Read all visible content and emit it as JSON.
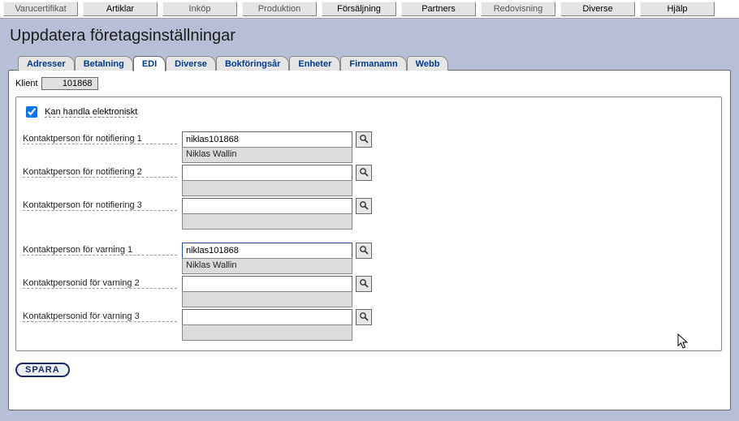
{
  "topbar": {
    "items": [
      {
        "label": "Varucertifikat",
        "enabled": false
      },
      {
        "label": "Artiklar",
        "enabled": true
      },
      {
        "label": "Inköp",
        "enabled": false
      },
      {
        "label": "Produktion",
        "enabled": false
      },
      {
        "label": "Försäljning",
        "enabled": true
      },
      {
        "label": "Partners",
        "enabled": true
      },
      {
        "label": "Redovisning",
        "enabled": false
      },
      {
        "label": "Diverse",
        "enabled": true
      },
      {
        "label": "Hjälp",
        "enabled": true
      }
    ]
  },
  "page": {
    "title": "Uppdatera företagsinställningar"
  },
  "tabs": [
    {
      "label": "Adresser",
      "active": false
    },
    {
      "label": "Betalning",
      "active": false
    },
    {
      "label": "EDI",
      "active": true
    },
    {
      "label": "Diverse",
      "active": false
    },
    {
      "label": "Bokföringsår",
      "active": false
    },
    {
      "label": "Enheter",
      "active": false
    },
    {
      "label": "Firmanamn",
      "active": false
    },
    {
      "label": "Webb",
      "active": false
    }
  ],
  "klient": {
    "label": "Klient",
    "value": "101868"
  },
  "edi": {
    "checkbox_label": "Kan handla elektroniskt",
    "checkbox_checked": true,
    "notify": [
      {
        "label": "Kontaktperson för notifiering 1",
        "value": "niklas101868",
        "display": "Niklas Wallin"
      },
      {
        "label": "Kontaktperson för notifiering 2",
        "value": "",
        "display": ""
      },
      {
        "label": "Kontaktperson för notifiering 3",
        "value": "",
        "display": ""
      }
    ],
    "warn": [
      {
        "label": "Kontaktperson för varning 1",
        "value": "niklas101868",
        "display": "Niklas Wallin"
      },
      {
        "label": "Kontaktpersonid för varning 2",
        "value": "",
        "display": ""
      },
      {
        "label": "Kontaktpersonid för varning 3",
        "value": "",
        "display": ""
      }
    ]
  },
  "buttons": {
    "save": "SPARA"
  }
}
